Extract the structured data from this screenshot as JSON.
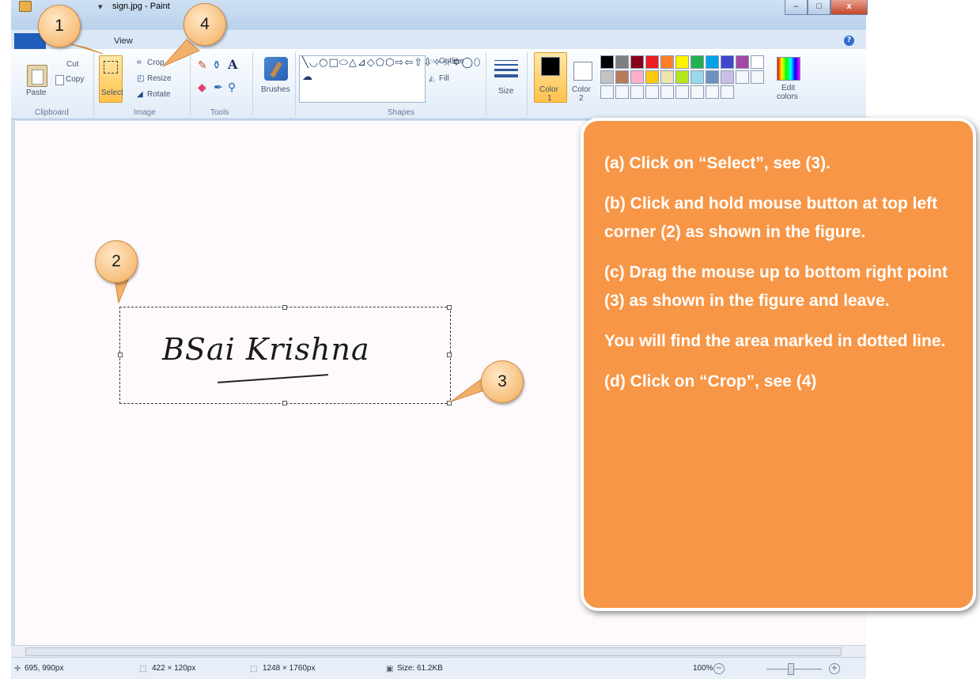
{
  "window": {
    "title": "sign.jpg - Paint",
    "tabs": {
      "view": "View"
    },
    "controls": {
      "minimize": "–",
      "maximize": "□",
      "close": "x"
    }
  },
  "ribbon": {
    "clipboard": {
      "paste": "Paste",
      "cut": "Cut",
      "copy": "Copy",
      "group": "Clipboard"
    },
    "image": {
      "select": "Select",
      "crop": "Crop",
      "resize": "Resize",
      "rotate": "Rotate",
      "group": "Image"
    },
    "tools": {
      "group": "Tools"
    },
    "brushes": {
      "label": "Brushes"
    },
    "shapes": {
      "outline": "Outline",
      "fill": "Fill",
      "group": "Shapes",
      "glyphs": "╲◡○□⬭△⊿◇⬠⬡⇨⇦⇧⇩✧☆✡◯⬯☁"
    },
    "size": {
      "label": "Size"
    },
    "colors": {
      "color1_label": "Color",
      "color1_num": "1",
      "color2_label": "Color",
      "color2_num": "2",
      "color1": "#000000",
      "color2": "#ffffff",
      "edit_label_1": "Edit",
      "edit_label_2": "colors",
      "palette": [
        "#000000",
        "#7f7f7f",
        "#880015",
        "#ed1c24",
        "#ff7f27",
        "#fff200",
        "#22b14c",
        "#00a2e8",
        "#3f48cc",
        "#a349a4",
        "#ffffff",
        "#c3c3c3",
        "#b97a57",
        "#ffaec9",
        "#ffc90e",
        "#efe4b0",
        "#b5e61d",
        "#99d9ea",
        "#7092be",
        "#c8bfe7",
        "",
        "",
        "",
        "",
        "",
        "",
        "",
        "",
        "",
        "",
        ""
      ]
    }
  },
  "canvas": {
    "signature_text": "BSai Krishna"
  },
  "status": {
    "cursor_pos": "695, 990px",
    "selection_size": "422 × 120px",
    "image_size": "1248 × 1760px",
    "file_size": "Size: 61.2KB",
    "zoom": "100%"
  },
  "callouts": {
    "c1": "1",
    "c2": "2",
    "c3": "3",
    "c4": "4"
  },
  "instructions": {
    "a": "(a) Click on “Select”, see (3).",
    "b": "(b) Click and hold mouse button at top left corner (2) as shown in the figure.",
    "c": "(c) Drag the mouse up to bottom right point (3) as shown in the figure and leave.",
    "note": "You will find the area marked in dotted line.",
    "d": "(d) Click on “Crop”, see (4)"
  }
}
